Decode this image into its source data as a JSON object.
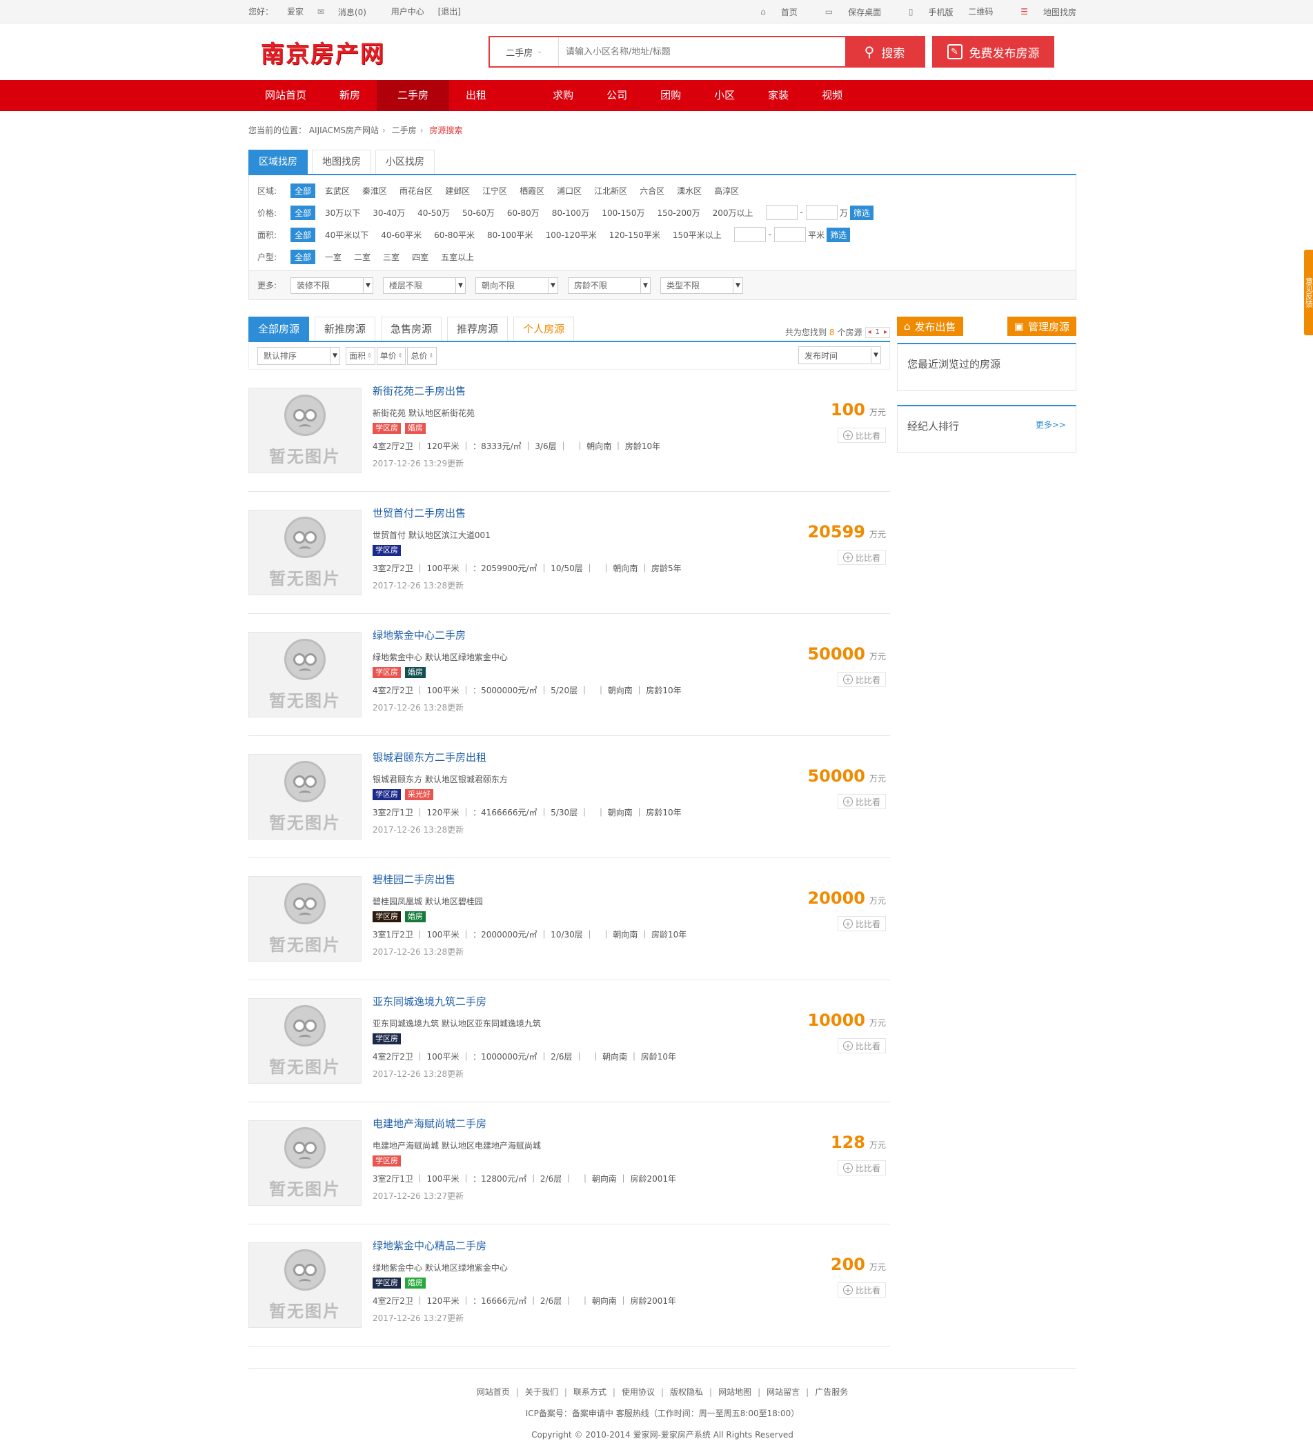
{
  "topbar": {
    "greeting": "您好：",
    "user": "爱家",
    "messages": "消息(0)",
    "user_center": "用户中心",
    "logout": "[退出]",
    "home": "首页",
    "save_desktop": "保存桌面",
    "mobile": "手机版",
    "qrcode": "二维码",
    "map_search": "地图找房"
  },
  "header": {
    "logo": "南京房产网",
    "search_category": "二手房",
    "search_placeholder": "请输入小区名称/地址/标题",
    "search_button": "搜索",
    "publish_button": "免费发布房源"
  },
  "nav": [
    "网站首页",
    "新房",
    "二手房",
    "出租",
    "",
    "求购",
    "公司",
    "团购",
    "小区",
    "家装",
    "视频"
  ],
  "nav_active": 2,
  "breadcrumb": {
    "prefix": "您当前的位置：",
    "items": [
      "AIJIACMS房产网站",
      "二手房"
    ],
    "current": "房源搜索"
  },
  "filter_tabs": [
    "区域找房",
    "地图找房",
    "小区找房"
  ],
  "filters": {
    "region": {
      "label": "区域:",
      "all": "全部",
      "options": [
        "玄武区",
        "秦淮区",
        "雨花台区",
        "建邺区",
        "江宁区",
        "栖霞区",
        "浦口区",
        "江北新区",
        "六合区",
        "溧水区",
        "高淳区"
      ]
    },
    "price": {
      "label": "价格:",
      "all": "全部",
      "options": [
        "30万以下",
        "30-40万",
        "40-50万",
        "50-60万",
        "60-80万",
        "80-100万",
        "100-150万",
        "150-200万",
        "200万以上"
      ],
      "unit": "万",
      "go": "筛选"
    },
    "area": {
      "label": "面积:",
      "all": "全部",
      "options": [
        "40平米以下",
        "40-60平米",
        "60-80平米",
        "80-100平米",
        "100-120平米",
        "120-150平米",
        "150平米以上"
      ],
      "unit": "平米",
      "go": "筛选"
    },
    "layout": {
      "label": "户型:",
      "all": "全部",
      "options": [
        "一室",
        "二室",
        "三室",
        "四室",
        "五室以上"
      ]
    },
    "more": {
      "label": "更多:",
      "selects": [
        "装修不限",
        "楼层不限",
        "朝向不限",
        "房龄不限",
        "类型不限"
      ]
    }
  },
  "list_tabs": [
    "全部房源",
    "新推房源",
    "急售房源",
    "推荐房源",
    "个人房源"
  ],
  "count": {
    "prefix": "共为您找到",
    "num": "8",
    "suffix": "个房源",
    "page": "1"
  },
  "sort": {
    "default": "默认排序",
    "area": "面积",
    "unit_price": "单价",
    "total_price": "总价",
    "time": "发布时间"
  },
  "nopic_text": "暂无图片",
  "compare_label": "比比看",
  "price_unit": "万元",
  "houses": [
    {
      "title": "新街花苑二手房出售",
      "addr": "新街花苑 默认地区新街花苑",
      "tags": [
        {
          "t": "学区房",
          "c": "#e9544f"
        },
        {
          "t": "婚房",
          "c": "#e9544f"
        }
      ],
      "attr": "4室2厅2卫 ｜ 120平米 ｜ ：8333元/㎡ ｜ 3/6层 ｜　｜ 朝向南 ｜ 房龄10年",
      "date": "2017-12-26 13:29更新",
      "price": "100"
    },
    {
      "title": "世贸首付二手房出售",
      "addr": "世贸首付 默认地区滨江大道001",
      "tags": [
        {
          "t": "学区房",
          "c": "#1b2a8a"
        }
      ],
      "attr": "3室2厅2卫 ｜ 100平米 ｜ ：2059900元/㎡ ｜ 10/50层 ｜　｜ 朝向南 ｜ 房龄5年",
      "date": "2017-12-26 13:28更新",
      "price": "20599"
    },
    {
      "title": "绿地紫金中心二手房",
      "addr": "绿地紫金中心 默认地区绿地紫金中心",
      "tags": [
        {
          "t": "学区房",
          "c": "#e9544f"
        },
        {
          "t": "婚房",
          "c": "#124f4f"
        }
      ],
      "attr": "4室2厅2卫 ｜ 100平米 ｜ ：5000000元/㎡ ｜ 5/20层 ｜　｜ 朝向南 ｜ 房龄10年",
      "date": "2017-12-26 13:28更新",
      "price": "50000"
    },
    {
      "title": "银城君颐东方二手房出租",
      "addr": "银城君颐东方 默认地区银城君颐东方",
      "tags": [
        {
          "t": "学区房",
          "c": "#1b2a8a"
        },
        {
          "t": "采光好",
          "c": "#e9544f"
        }
      ],
      "attr": "3室2厅1卫 ｜ 120平米 ｜ ：4166666元/㎡ ｜ 5/30层 ｜　｜ 朝向南 ｜ 房龄10年",
      "date": "2017-12-26 13:28更新",
      "price": "50000"
    },
    {
      "title": "碧桂园二手房出售",
      "addr": "碧桂园凤凰城 默认地区碧桂园",
      "tags": [
        {
          "t": "学区房",
          "c": "#2b1a0a"
        },
        {
          "t": "婚房",
          "c": "#147a3a"
        }
      ],
      "attr": "3室1厅2卫 ｜ 100平米 ｜ ：2000000元/㎡ ｜ 10/30层 ｜　｜ 朝向南 ｜ 房龄10年",
      "date": "2017-12-26 13:28更新",
      "price": "20000"
    },
    {
      "title": "亚东同城逸境九筑二手房",
      "addr": "亚东同城逸境九筑 默认地区亚东同城逸境九筑",
      "tags": [
        {
          "t": "学区房",
          "c": "#1b2a4a"
        }
      ],
      "attr": "4室2厅2卫 ｜ 100平米 ｜ ：1000000元/㎡ ｜ 2/6层 ｜　｜ 朝向南 ｜ 房龄10年",
      "date": "2017-12-26 13:28更新",
      "price": "10000"
    },
    {
      "title": "电建地产海赋尚城二手房",
      "addr": "电建地产海赋尚城 默认地区电建地产海赋尚城",
      "tags": [
        {
          "t": "学区房",
          "c": "#e9544f"
        }
      ],
      "attr": "3室2厅1卫 ｜ 100平米 ｜ ：12800元/㎡ ｜ 2/6层 ｜　｜ 朝向南 ｜ 房龄2001年",
      "date": "2017-12-26 13:27更新",
      "price": "128"
    },
    {
      "title": "绿地紫金中心精品二手房",
      "addr": "绿地紫金中心 默认地区绿地紫金中心",
      "tags": [
        {
          "t": "学区房",
          "c": "#1b2a4a"
        },
        {
          "t": "婚房",
          "c": "#28a83c"
        }
      ],
      "attr": "4室2厅2卫 ｜ 120平米 ｜ ：16666元/㎡ ｜ 2/6层 ｜　｜ 朝向南 ｜ 房龄2001年",
      "date": "2017-12-26 13:27更新",
      "price": "200"
    }
  ],
  "sidebar": {
    "sell_button": "发布出售",
    "manage_button": "管理房源",
    "recent_title": "您最近浏览过的房源",
    "agent_title": "经纪人排行",
    "more": "更多>>"
  },
  "float_tab": "意见反馈",
  "footer": {
    "links": [
      "网站首页",
      "关于我们",
      "联系方式",
      "使用协议",
      "版权隐私",
      "网站地图",
      "网站留言",
      "广告服务"
    ],
    "icp": "ICP备案号：备案申请中 客服热线（工作时间：周一至周五8:00至18:00）",
    "copyright": "Copyright © 2010-2014 爱家网-爱家房产系统 All Rights Reserved"
  },
  "colors": {
    "nav_red": "#d9000c",
    "accent_blue": "#2d8dd6",
    "price_orange": "#f08a00",
    "brand_red": "#e4393c"
  }
}
